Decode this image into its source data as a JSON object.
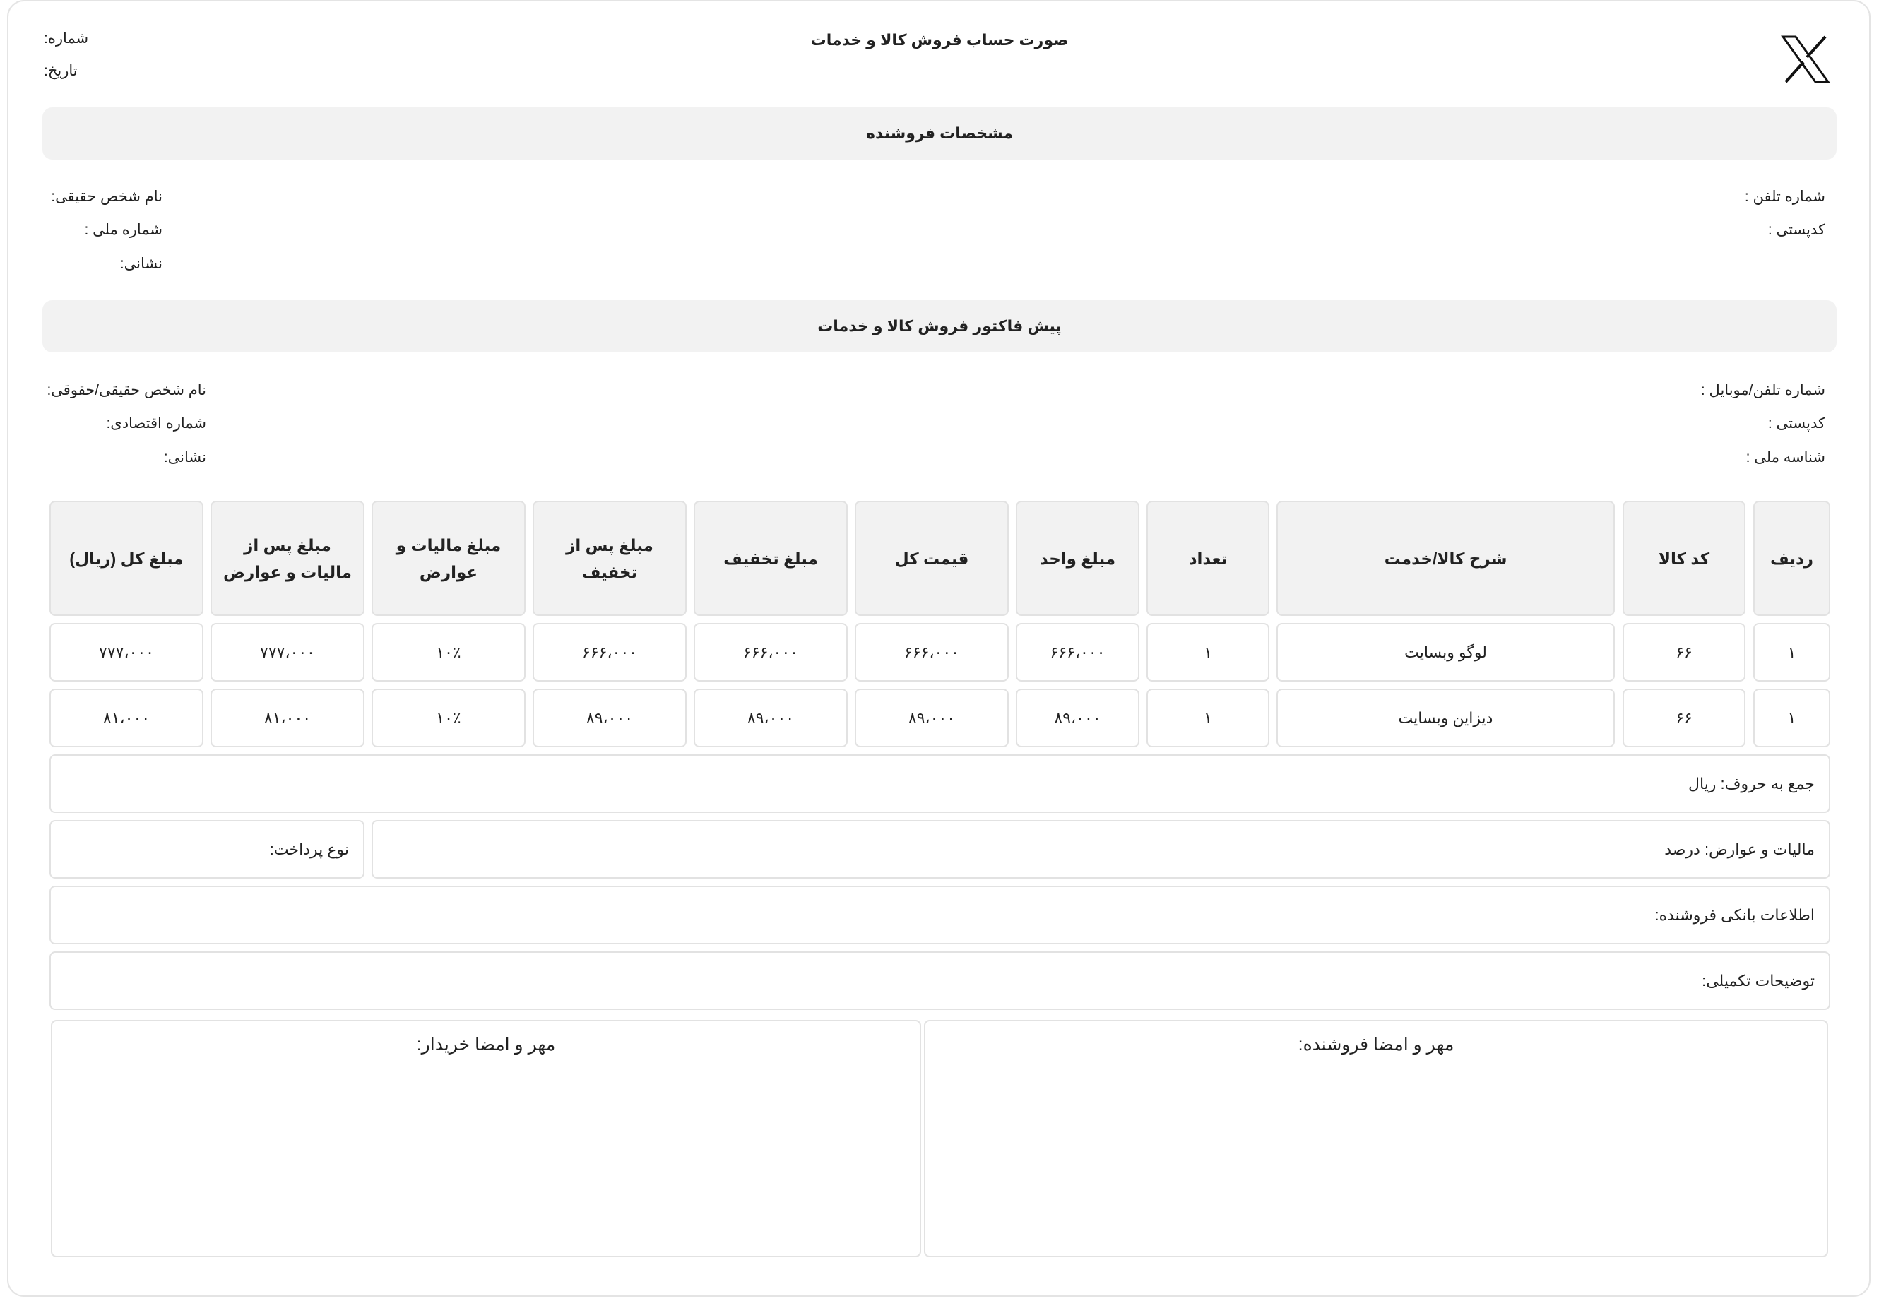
{
  "header": {
    "title": "صورت حساب فروش کالا و خدمات",
    "number_label": "شماره:",
    "date_label": "تاریخ:"
  },
  "seller": {
    "section_title": "مشخصات فروشنده",
    "phone_label": "شماره تلفن :",
    "postal_label": "کدپستی :",
    "name_label": "نام شخص حقیقی:",
    "national_id_label": "شماره ملی :",
    "address_label": "نشانی:"
  },
  "buyer": {
    "section_title": "پیش فاکتور فروش کالا و خدمات",
    "phone_label": "شماره تلفن/موبایل :",
    "postal_label": "کدپستی :",
    "national_id_label": "شناسه ملی :",
    "name_label": "نام شخص حقیقی/حقوقی:",
    "economic_label": "شماره اقتصادی:",
    "address_label": "نشانی:"
  },
  "table": {
    "headers": [
      "ردیف",
      "کد کالا",
      "شرح کالا/خدمت",
      "تعداد",
      "مبلغ واحد",
      "قیمت کل",
      "مبلغ تخفیف",
      "مبلغ پس از تخفیف",
      "مبلغ مالیات و عوارض",
      "مبلغ پس از مالیات و عوارض",
      "مبلغ کل (ریال)"
    ],
    "rows": [
      [
        "۱",
        "۶۶",
        "لوگو وبسایت",
        "۱",
        "۶۶۶،۰۰۰",
        "۶۶۶،۰۰۰",
        "۶۶۶،۰۰۰",
        "۶۶۶،۰۰۰",
        "۱۰٪",
        "۷۷۷،۰۰۰",
        "۷۷۷،۰۰۰"
      ],
      [
        "۱",
        "۶۶",
        "دیزاین وبسایت",
        "۱",
        "۸۹،۰۰۰",
        "۸۹،۰۰۰",
        "۸۹،۰۰۰",
        "۸۹،۰۰۰",
        "۱۰٪",
        "۸۱،۰۰۰",
        "۸۱،۰۰۰"
      ]
    ]
  },
  "summary": {
    "total_in_words": "جمع به حروف: ریال",
    "tax_label": "مالیات و عوارض: درصد",
    "payment_type_label": "نوع پرداخت:",
    "bank_info_label": "اطلاعات بانکی فروشنده:",
    "notes_label": "توضیحات تکمیلی:"
  },
  "signatures": {
    "seller": "مهر و امضا فروشنده:",
    "buyer": "مهر و امضا خریدار:"
  },
  "logo_icon": "x-logo-icon"
}
